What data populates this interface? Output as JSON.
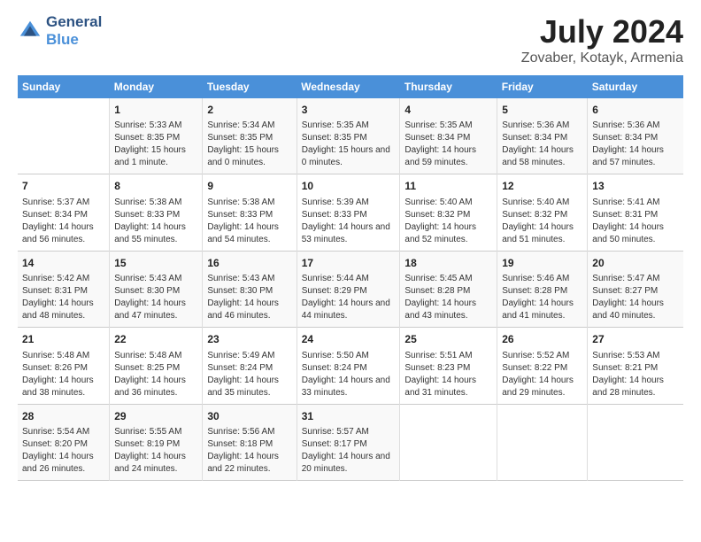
{
  "logo": {
    "line1": "General",
    "line2": "Blue"
  },
  "title": "July 2024",
  "subtitle": "Zovaber, Kotayk, Armenia",
  "weekdays": [
    "Sunday",
    "Monday",
    "Tuesday",
    "Wednesday",
    "Thursday",
    "Friday",
    "Saturday"
  ],
  "weeks": [
    [
      {
        "day": "",
        "sunrise": "",
        "sunset": "",
        "daylight": ""
      },
      {
        "day": "1",
        "sunrise": "Sunrise: 5:33 AM",
        "sunset": "Sunset: 8:35 PM",
        "daylight": "Daylight: 15 hours and 1 minute."
      },
      {
        "day": "2",
        "sunrise": "Sunrise: 5:34 AM",
        "sunset": "Sunset: 8:35 PM",
        "daylight": "Daylight: 15 hours and 0 minutes."
      },
      {
        "day": "3",
        "sunrise": "Sunrise: 5:35 AM",
        "sunset": "Sunset: 8:35 PM",
        "daylight": "Daylight: 15 hours and 0 minutes."
      },
      {
        "day": "4",
        "sunrise": "Sunrise: 5:35 AM",
        "sunset": "Sunset: 8:34 PM",
        "daylight": "Daylight: 14 hours and 59 minutes."
      },
      {
        "day": "5",
        "sunrise": "Sunrise: 5:36 AM",
        "sunset": "Sunset: 8:34 PM",
        "daylight": "Daylight: 14 hours and 58 minutes."
      },
      {
        "day": "6",
        "sunrise": "Sunrise: 5:36 AM",
        "sunset": "Sunset: 8:34 PM",
        "daylight": "Daylight: 14 hours and 57 minutes."
      }
    ],
    [
      {
        "day": "7",
        "sunrise": "Sunrise: 5:37 AM",
        "sunset": "Sunset: 8:34 PM",
        "daylight": "Daylight: 14 hours and 56 minutes."
      },
      {
        "day": "8",
        "sunrise": "Sunrise: 5:38 AM",
        "sunset": "Sunset: 8:33 PM",
        "daylight": "Daylight: 14 hours and 55 minutes."
      },
      {
        "day": "9",
        "sunrise": "Sunrise: 5:38 AM",
        "sunset": "Sunset: 8:33 PM",
        "daylight": "Daylight: 14 hours and 54 minutes."
      },
      {
        "day": "10",
        "sunrise": "Sunrise: 5:39 AM",
        "sunset": "Sunset: 8:33 PM",
        "daylight": "Daylight: 14 hours and 53 minutes."
      },
      {
        "day": "11",
        "sunrise": "Sunrise: 5:40 AM",
        "sunset": "Sunset: 8:32 PM",
        "daylight": "Daylight: 14 hours and 52 minutes."
      },
      {
        "day": "12",
        "sunrise": "Sunrise: 5:40 AM",
        "sunset": "Sunset: 8:32 PM",
        "daylight": "Daylight: 14 hours and 51 minutes."
      },
      {
        "day": "13",
        "sunrise": "Sunrise: 5:41 AM",
        "sunset": "Sunset: 8:31 PM",
        "daylight": "Daylight: 14 hours and 50 minutes."
      }
    ],
    [
      {
        "day": "14",
        "sunrise": "Sunrise: 5:42 AM",
        "sunset": "Sunset: 8:31 PM",
        "daylight": "Daylight: 14 hours and 48 minutes."
      },
      {
        "day": "15",
        "sunrise": "Sunrise: 5:43 AM",
        "sunset": "Sunset: 8:30 PM",
        "daylight": "Daylight: 14 hours and 47 minutes."
      },
      {
        "day": "16",
        "sunrise": "Sunrise: 5:43 AM",
        "sunset": "Sunset: 8:30 PM",
        "daylight": "Daylight: 14 hours and 46 minutes."
      },
      {
        "day": "17",
        "sunrise": "Sunrise: 5:44 AM",
        "sunset": "Sunset: 8:29 PM",
        "daylight": "Daylight: 14 hours and 44 minutes."
      },
      {
        "day": "18",
        "sunrise": "Sunrise: 5:45 AM",
        "sunset": "Sunset: 8:28 PM",
        "daylight": "Daylight: 14 hours and 43 minutes."
      },
      {
        "day": "19",
        "sunrise": "Sunrise: 5:46 AM",
        "sunset": "Sunset: 8:28 PM",
        "daylight": "Daylight: 14 hours and 41 minutes."
      },
      {
        "day": "20",
        "sunrise": "Sunrise: 5:47 AM",
        "sunset": "Sunset: 8:27 PM",
        "daylight": "Daylight: 14 hours and 40 minutes."
      }
    ],
    [
      {
        "day": "21",
        "sunrise": "Sunrise: 5:48 AM",
        "sunset": "Sunset: 8:26 PM",
        "daylight": "Daylight: 14 hours and 38 minutes."
      },
      {
        "day": "22",
        "sunrise": "Sunrise: 5:48 AM",
        "sunset": "Sunset: 8:25 PM",
        "daylight": "Daylight: 14 hours and 36 minutes."
      },
      {
        "day": "23",
        "sunrise": "Sunrise: 5:49 AM",
        "sunset": "Sunset: 8:24 PM",
        "daylight": "Daylight: 14 hours and 35 minutes."
      },
      {
        "day": "24",
        "sunrise": "Sunrise: 5:50 AM",
        "sunset": "Sunset: 8:24 PM",
        "daylight": "Daylight: 14 hours and 33 minutes."
      },
      {
        "day": "25",
        "sunrise": "Sunrise: 5:51 AM",
        "sunset": "Sunset: 8:23 PM",
        "daylight": "Daylight: 14 hours and 31 minutes."
      },
      {
        "day": "26",
        "sunrise": "Sunrise: 5:52 AM",
        "sunset": "Sunset: 8:22 PM",
        "daylight": "Daylight: 14 hours and 29 minutes."
      },
      {
        "day": "27",
        "sunrise": "Sunrise: 5:53 AM",
        "sunset": "Sunset: 8:21 PM",
        "daylight": "Daylight: 14 hours and 28 minutes."
      }
    ],
    [
      {
        "day": "28",
        "sunrise": "Sunrise: 5:54 AM",
        "sunset": "Sunset: 8:20 PM",
        "daylight": "Daylight: 14 hours and 26 minutes."
      },
      {
        "day": "29",
        "sunrise": "Sunrise: 5:55 AM",
        "sunset": "Sunset: 8:19 PM",
        "daylight": "Daylight: 14 hours and 24 minutes."
      },
      {
        "day": "30",
        "sunrise": "Sunrise: 5:56 AM",
        "sunset": "Sunset: 8:18 PM",
        "daylight": "Daylight: 14 hours and 22 minutes."
      },
      {
        "day": "31",
        "sunrise": "Sunrise: 5:57 AM",
        "sunset": "Sunset: 8:17 PM",
        "daylight": "Daylight: 14 hours and 20 minutes."
      },
      {
        "day": "",
        "sunrise": "",
        "sunset": "",
        "daylight": ""
      },
      {
        "day": "",
        "sunrise": "",
        "sunset": "",
        "daylight": ""
      },
      {
        "day": "",
        "sunrise": "",
        "sunset": "",
        "daylight": ""
      }
    ]
  ]
}
